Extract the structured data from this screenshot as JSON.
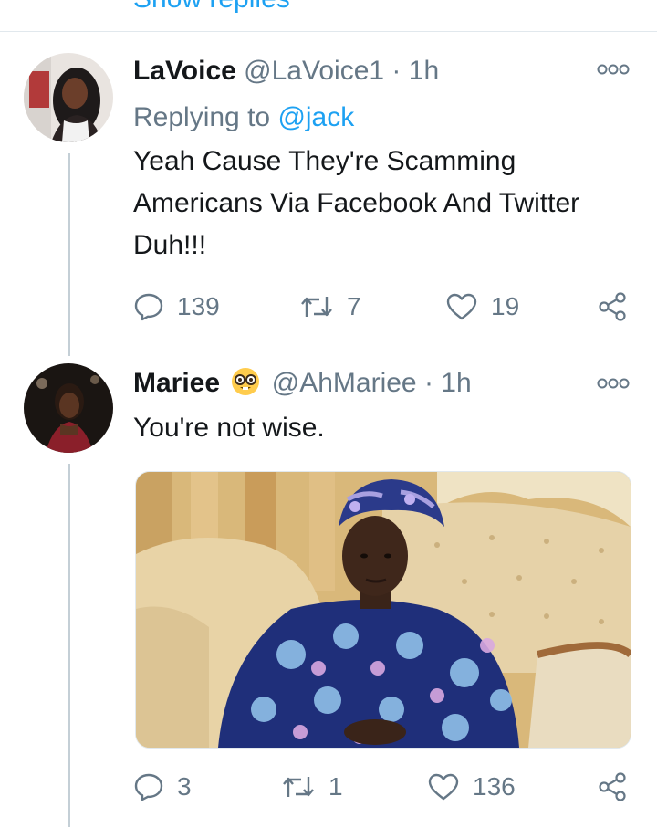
{
  "top": {
    "show_replies": "Show replies"
  },
  "tweets": [
    {
      "name": "LaVoice",
      "handle": "@LaVoice1",
      "separator": "·",
      "time": "1h",
      "replying_prefix": "Replying to",
      "replying_to": "@jack",
      "text": "Yeah Cause They're Scamming Americans Via Facebook And Twitter Duh!!!",
      "replies": "139",
      "retweets": "7",
      "likes": "19"
    },
    {
      "name": "Mariee",
      "name_emoji": "nerd-face-emoji",
      "handle": "@AhMariee",
      "separator": "·",
      "time": "1h",
      "text": "You're not wise.",
      "replies": "3",
      "retweets": "1",
      "likes": "136"
    }
  ],
  "icons": {
    "reply": "reply-icon",
    "retweet": "retweet-icon",
    "like": "heart-icon",
    "share": "share-icon",
    "more": "more-options-icon"
  },
  "colors": {
    "link": "#1da1f2",
    "secondary": "#657786",
    "text": "#14171a",
    "divider": "#e1e8ed"
  }
}
